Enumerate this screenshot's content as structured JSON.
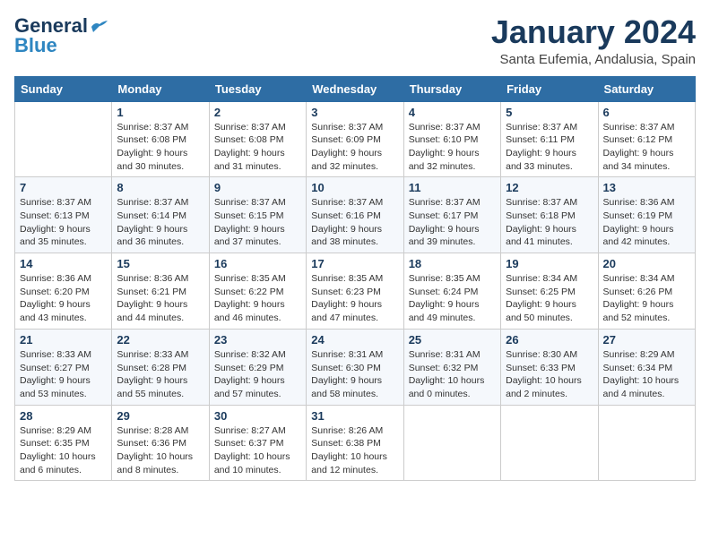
{
  "header": {
    "logo_line1": "General",
    "logo_line2": "Blue",
    "month": "January 2024",
    "location": "Santa Eufemia, Andalusia, Spain"
  },
  "days_of_week": [
    "Sunday",
    "Monday",
    "Tuesday",
    "Wednesday",
    "Thursday",
    "Friday",
    "Saturday"
  ],
  "weeks": [
    [
      {
        "day": "",
        "sunrise": "",
        "sunset": "",
        "daylight": ""
      },
      {
        "day": "1",
        "sunrise": "Sunrise: 8:37 AM",
        "sunset": "Sunset: 6:08 PM",
        "daylight": "Daylight: 9 hours and 30 minutes."
      },
      {
        "day": "2",
        "sunrise": "Sunrise: 8:37 AM",
        "sunset": "Sunset: 6:08 PM",
        "daylight": "Daylight: 9 hours and 31 minutes."
      },
      {
        "day": "3",
        "sunrise": "Sunrise: 8:37 AM",
        "sunset": "Sunset: 6:09 PM",
        "daylight": "Daylight: 9 hours and 32 minutes."
      },
      {
        "day": "4",
        "sunrise": "Sunrise: 8:37 AM",
        "sunset": "Sunset: 6:10 PM",
        "daylight": "Daylight: 9 hours and 32 minutes."
      },
      {
        "day": "5",
        "sunrise": "Sunrise: 8:37 AM",
        "sunset": "Sunset: 6:11 PM",
        "daylight": "Daylight: 9 hours and 33 minutes."
      },
      {
        "day": "6",
        "sunrise": "Sunrise: 8:37 AM",
        "sunset": "Sunset: 6:12 PM",
        "daylight": "Daylight: 9 hours and 34 minutes."
      }
    ],
    [
      {
        "day": "7",
        "sunrise": "Sunrise: 8:37 AM",
        "sunset": "Sunset: 6:13 PM",
        "daylight": "Daylight: 9 hours and 35 minutes."
      },
      {
        "day": "8",
        "sunrise": "Sunrise: 8:37 AM",
        "sunset": "Sunset: 6:14 PM",
        "daylight": "Daylight: 9 hours and 36 minutes."
      },
      {
        "day": "9",
        "sunrise": "Sunrise: 8:37 AM",
        "sunset": "Sunset: 6:15 PM",
        "daylight": "Daylight: 9 hours and 37 minutes."
      },
      {
        "day": "10",
        "sunrise": "Sunrise: 8:37 AM",
        "sunset": "Sunset: 6:16 PM",
        "daylight": "Daylight: 9 hours and 38 minutes."
      },
      {
        "day": "11",
        "sunrise": "Sunrise: 8:37 AM",
        "sunset": "Sunset: 6:17 PM",
        "daylight": "Daylight: 9 hours and 39 minutes."
      },
      {
        "day": "12",
        "sunrise": "Sunrise: 8:37 AM",
        "sunset": "Sunset: 6:18 PM",
        "daylight": "Daylight: 9 hours and 41 minutes."
      },
      {
        "day": "13",
        "sunrise": "Sunrise: 8:36 AM",
        "sunset": "Sunset: 6:19 PM",
        "daylight": "Daylight: 9 hours and 42 minutes."
      }
    ],
    [
      {
        "day": "14",
        "sunrise": "Sunrise: 8:36 AM",
        "sunset": "Sunset: 6:20 PM",
        "daylight": "Daylight: 9 hours and 43 minutes."
      },
      {
        "day": "15",
        "sunrise": "Sunrise: 8:36 AM",
        "sunset": "Sunset: 6:21 PM",
        "daylight": "Daylight: 9 hours and 44 minutes."
      },
      {
        "day": "16",
        "sunrise": "Sunrise: 8:35 AM",
        "sunset": "Sunset: 6:22 PM",
        "daylight": "Daylight: 9 hours and 46 minutes."
      },
      {
        "day": "17",
        "sunrise": "Sunrise: 8:35 AM",
        "sunset": "Sunset: 6:23 PM",
        "daylight": "Daylight: 9 hours and 47 minutes."
      },
      {
        "day": "18",
        "sunrise": "Sunrise: 8:35 AM",
        "sunset": "Sunset: 6:24 PM",
        "daylight": "Daylight: 9 hours and 49 minutes."
      },
      {
        "day": "19",
        "sunrise": "Sunrise: 8:34 AM",
        "sunset": "Sunset: 6:25 PM",
        "daylight": "Daylight: 9 hours and 50 minutes."
      },
      {
        "day": "20",
        "sunrise": "Sunrise: 8:34 AM",
        "sunset": "Sunset: 6:26 PM",
        "daylight": "Daylight: 9 hours and 52 minutes."
      }
    ],
    [
      {
        "day": "21",
        "sunrise": "Sunrise: 8:33 AM",
        "sunset": "Sunset: 6:27 PM",
        "daylight": "Daylight: 9 hours and 53 minutes."
      },
      {
        "day": "22",
        "sunrise": "Sunrise: 8:33 AM",
        "sunset": "Sunset: 6:28 PM",
        "daylight": "Daylight: 9 hours and 55 minutes."
      },
      {
        "day": "23",
        "sunrise": "Sunrise: 8:32 AM",
        "sunset": "Sunset: 6:29 PM",
        "daylight": "Daylight: 9 hours and 57 minutes."
      },
      {
        "day": "24",
        "sunrise": "Sunrise: 8:31 AM",
        "sunset": "Sunset: 6:30 PM",
        "daylight": "Daylight: 9 hours and 58 minutes."
      },
      {
        "day": "25",
        "sunrise": "Sunrise: 8:31 AM",
        "sunset": "Sunset: 6:32 PM",
        "daylight": "Daylight: 10 hours and 0 minutes."
      },
      {
        "day": "26",
        "sunrise": "Sunrise: 8:30 AM",
        "sunset": "Sunset: 6:33 PM",
        "daylight": "Daylight: 10 hours and 2 minutes."
      },
      {
        "day": "27",
        "sunrise": "Sunrise: 8:29 AM",
        "sunset": "Sunset: 6:34 PM",
        "daylight": "Daylight: 10 hours and 4 minutes."
      }
    ],
    [
      {
        "day": "28",
        "sunrise": "Sunrise: 8:29 AM",
        "sunset": "Sunset: 6:35 PM",
        "daylight": "Daylight: 10 hours and 6 minutes."
      },
      {
        "day": "29",
        "sunrise": "Sunrise: 8:28 AM",
        "sunset": "Sunset: 6:36 PM",
        "daylight": "Daylight: 10 hours and 8 minutes."
      },
      {
        "day": "30",
        "sunrise": "Sunrise: 8:27 AM",
        "sunset": "Sunset: 6:37 PM",
        "daylight": "Daylight: 10 hours and 10 minutes."
      },
      {
        "day": "31",
        "sunrise": "Sunrise: 8:26 AM",
        "sunset": "Sunset: 6:38 PM",
        "daylight": "Daylight: 10 hours and 12 minutes."
      },
      {
        "day": "",
        "sunrise": "",
        "sunset": "",
        "daylight": ""
      },
      {
        "day": "",
        "sunrise": "",
        "sunset": "",
        "daylight": ""
      },
      {
        "day": "",
        "sunrise": "",
        "sunset": "",
        "daylight": ""
      }
    ]
  ]
}
